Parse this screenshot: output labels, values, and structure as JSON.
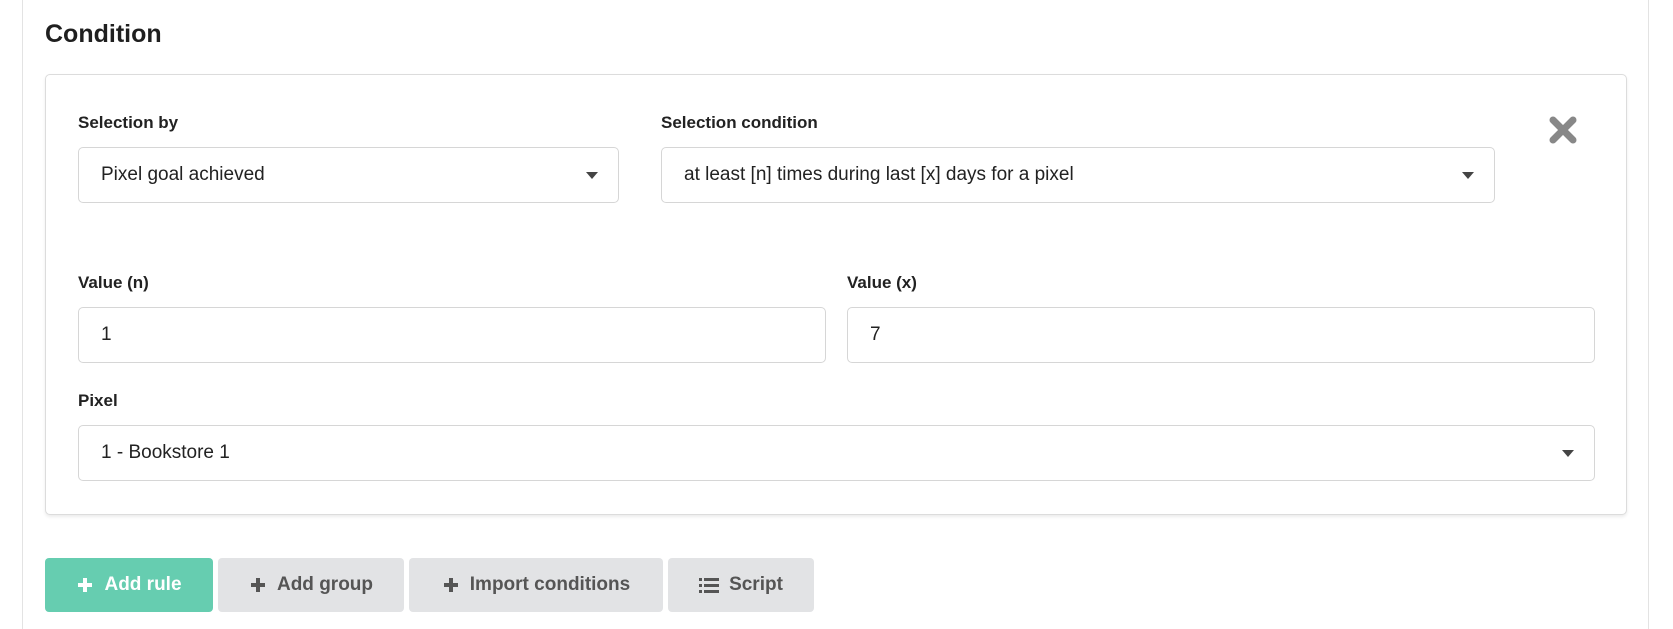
{
  "section": {
    "title": "Condition"
  },
  "rule": {
    "selection_by": {
      "label": "Selection by",
      "value": "Pixel goal achieved"
    },
    "selection_condition": {
      "label": "Selection condition",
      "value": "at least [n] times during last [x] days for a pixel"
    },
    "value_n": {
      "label": "Value (n)",
      "value": "1"
    },
    "value_x": {
      "label": "Value (x)",
      "value": "7"
    },
    "pixel": {
      "label": "Pixel",
      "value": "1 - Bookstore 1"
    }
  },
  "actions": {
    "add_rule": "Add rule",
    "add_group": "Add group",
    "import_conditions": "Import conditions",
    "script": "Script"
  },
  "colors": {
    "primary": "#66cdb0",
    "secondary": "#e2e3e5",
    "icon_gray": "#888888"
  }
}
